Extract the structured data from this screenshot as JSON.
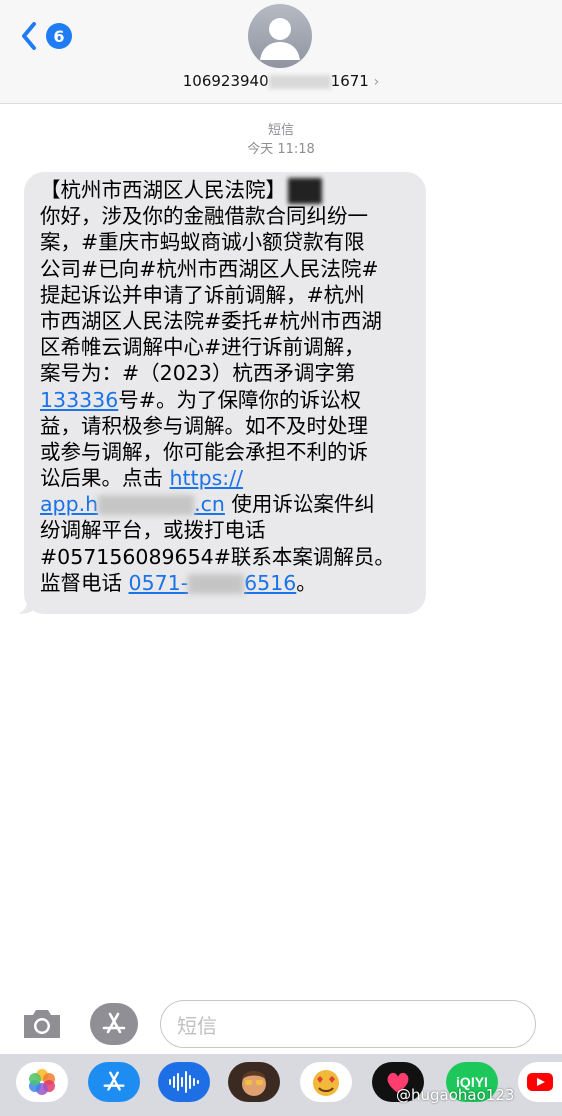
{
  "header": {
    "back_badge": "6",
    "contact_prefix": "106923940",
    "contact_suffix": "1671",
    "chevron": "›"
  },
  "meta": {
    "type": "短信",
    "time": "今天 11:18"
  },
  "message": {
    "l1": "【杭州市西湖区人民法院】",
    "l2": "你好，涉及你的金融借款合同纠纷一",
    "l3": "案，#重庆市蚂蚁商诚小额贷款有限",
    "l4": "公司#已向#杭州市西湖区人民法院#",
    "l5": "提起诉讼并申请了诉前调解，#杭州",
    "l6": "市西湖区人民法院#委托#杭州市西湖",
    "l7": "区希帷云调解中心#进行诉前调解，",
    "l8": "案号为：#（2023）杭西矛调字第",
    "l9_num": "133336",
    "l9_rest": "号#。为了保障你的诉讼权",
    "l10": "益，请积极参与调解。如不及时处理",
    "l11": "或参与调解，你可能会承担不利的诉",
    "l12_text": "讼后果。点击 ",
    "l12_link": "https://",
    "l13_link_a": "app.h",
    "l13_link_b": ".cn",
    "l13_rest": " 使用诉讼案件纠",
    "l14": "纷调解平台，或拨打电话",
    "l15": "#057156089654#联系本案调解员。",
    "l16_text": "监督电话 ",
    "l16_phone_a": "0571-",
    "l16_phone_b": "6516",
    "l16_end": "。"
  },
  "input": {
    "placeholder": "短信"
  },
  "watermark": "@hugaohao123",
  "colors": {
    "link": "#1a73e8",
    "badge": "#1f7cf5",
    "bubble": "#e9e9eb"
  }
}
